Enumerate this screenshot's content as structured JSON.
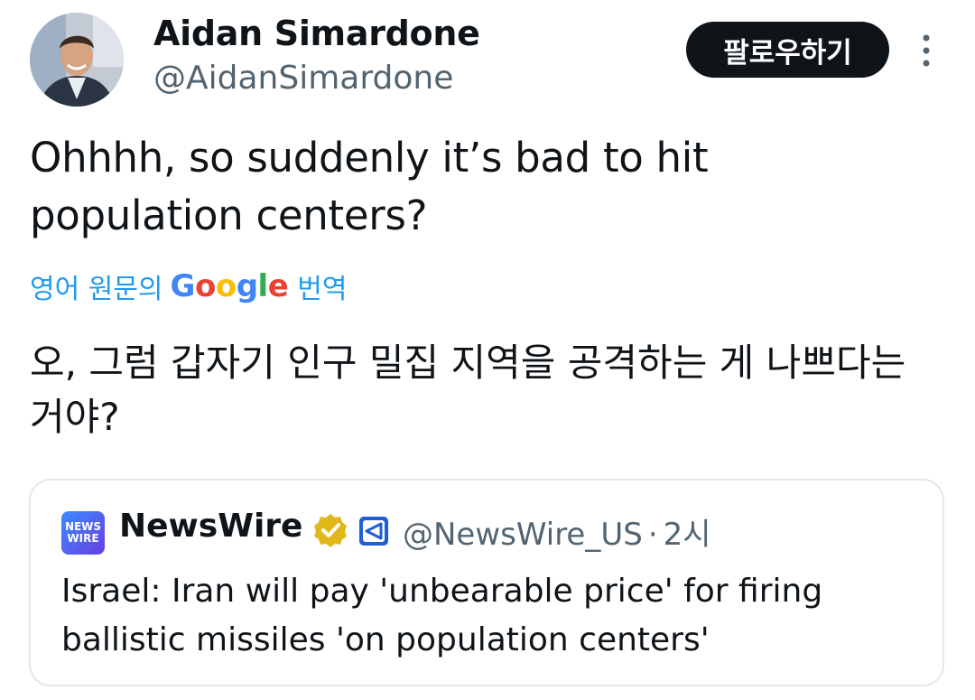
{
  "author": {
    "name": "Aidan Simardone",
    "handle": "@AidanSimardone"
  },
  "follow_button_label": "팔로우하기",
  "more_icon": "more-vertical-icon",
  "tweet": {
    "text": "Ohhhh, so suddenly it’s bad to hit population centers?"
  },
  "translation": {
    "prefix": "영어 원문의",
    "google_logo": "Google",
    "suffix": "번역",
    "text": "오, 그럼 갑자기 인구 밀집 지역을 공격하는 게 나쁘다는 거야?"
  },
  "quoted_tweet": {
    "logo_text_line1": "NEWS",
    "logo_text_line2": "WIRE",
    "name": "NewsWire",
    "verified_icon": "gold-verified-badge-icon",
    "affiliate_icon": "affiliate-badge-icon",
    "handle": "@NewsWire_US",
    "separator": "·",
    "time": "2시",
    "text": "Israel: Iran will pay 'unbearable price' for firing ballistic missiles 'on population centers'"
  },
  "colors": {
    "link_blue": "#1d9bf0",
    "secondary_text": "#536471",
    "primary_text": "#0f1419",
    "verified_gold": "#e2b719"
  }
}
